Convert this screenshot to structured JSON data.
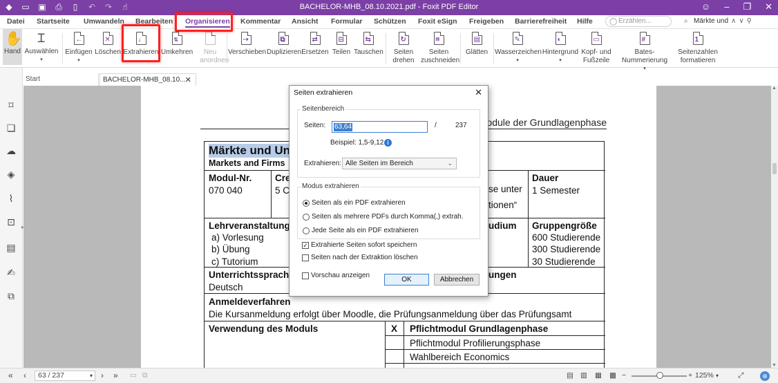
{
  "titlebar": {
    "title": "BACHELOR-MHB_08.10.2021.pdf - Foxit PDF Editor",
    "quick_access": [
      "logo-icon",
      "open-icon",
      "save-icon",
      "print-icon",
      "new-icon",
      "undo-icon",
      "redo-icon",
      "hand-select-icon"
    ],
    "controls": [
      "account-icon",
      "minimize-icon",
      "restore-icon",
      "close-icon"
    ]
  },
  "menu": {
    "items": [
      "Datei",
      "Startseite",
      "Umwandeln",
      "Bearbeiten",
      "Organisieren",
      "Kommentar",
      "Ansicht",
      "Formular",
      "Schützen",
      "Foxit eSign",
      "Freigeben",
      "Barrierefreiheit",
      "Hilfe"
    ],
    "active": "Organisieren",
    "tell_me_placeholder": "Erzählen...",
    "find_value": "Märkte und"
  },
  "ribbon": {
    "buttons": [
      {
        "label": "Hand",
        "icon": "hand-icon"
      },
      {
        "label": "Auswählen",
        "icon": "select-text-icon"
      },
      {
        "label": "Einfügen",
        "icon": "insert-page-icon"
      },
      {
        "label": "Löschen",
        "icon": "delete-page-icon"
      },
      {
        "label": "Extrahieren",
        "icon": "extract-page-icon"
      },
      {
        "label": "Umkehren",
        "icon": "reverse-pages-icon"
      },
      {
        "label": "Neu anordnen",
        "icon": "reorder-pages-icon"
      },
      {
        "label": "Verschieben",
        "icon": "move-pages-icon"
      },
      {
        "label": "Duplizieren",
        "icon": "duplicate-pages-icon"
      },
      {
        "label": "Ersetzen",
        "icon": "replace-pages-icon"
      },
      {
        "label": "Teilen",
        "icon": "split-pages-icon"
      },
      {
        "label": "Tauschen",
        "icon": "swap-pages-icon"
      },
      {
        "label": "Seiten drehen",
        "icon": "rotate-pages-icon"
      },
      {
        "label": "Seiten zuschneiden",
        "icon": "crop-pages-icon"
      },
      {
        "label": "Glätten",
        "icon": "flatten-icon"
      },
      {
        "label": "Wasserzeichen",
        "icon": "watermark-icon"
      },
      {
        "label": "Hintergrund",
        "icon": "background-icon"
      },
      {
        "label": "Kopf- und Fußzeile",
        "icon": "header-footer-icon"
      },
      {
        "label": "Bates-Nummerierung",
        "icon": "bates-numbering-icon"
      },
      {
        "label": "Seitenzahlen formatieren",
        "icon": "format-page-numbers-icon"
      }
    ]
  },
  "tabs": [
    {
      "label": "Start"
    },
    {
      "label": "BACHELOR-MHB_08.10...."
    }
  ],
  "document": {
    "header": "module der Grundlagenphase",
    "module_title": "Märkte und Unt",
    "module_subtitle": "Markets and Firms",
    "modul_nr_label": "Modul-Nr.",
    "modul_nr_value": "070 040",
    "credits_label": "Cre",
    "credits_value": "5 C",
    "col3_line1": "se unter",
    "col3_line2": "tionen“",
    "dauer_label": "Dauer",
    "dauer_value": "1 Semester",
    "lehrveranstaltungen_label": "Lehrveranstaltunge",
    "lv_items": [
      "a) Vorlesung",
      "b) Übung",
      "c) Tutorium"
    ],
    "udium_label": "udium",
    "gruppengroesse_label": "Gruppengröße",
    "group_sizes": [
      "600 Studierende",
      "300 Studierende",
      "30 Studierende"
    ],
    "unterrichtssprache_label": "Unterrichtssprache",
    "unterrichtssprache_value": "Deutsch",
    "ungen_label": "ungen",
    "anmeldeverfahren_label": "Anmeldeverfahren",
    "anmeldeverfahren_text": "Die Kursanmeldung erfolgt über Moodle, die Prüfungsanmeldung über das Prüfungsamt",
    "verwendung_label": "Verwendung des Moduls",
    "x_mark": "X",
    "verwendung_items": [
      "Pflichtmodul Grundlagenphase",
      "Pflichtmodul Profilierungsphase",
      "Wahlbereich Economics"
    ]
  },
  "dialog": {
    "title": "Seiten extrahieren",
    "range_group": "Seitenbereich",
    "seiten_label": "Seiten:",
    "seiten_value": "63,64",
    "separator": "/",
    "total_pages": "237",
    "example": "Beispiel: 1,5-9,12",
    "extract_label": "Extrahieren:",
    "extract_option": "Alle Seiten im Bereich",
    "mode_group": "Modus extrahieren",
    "mode_options": [
      "Seiten als ein PDF extrahieren",
      "Seiten als mehrere PDFs durch Komma(,) extrah.",
      "Jede Seite als ein PDF extrahieren"
    ],
    "mode_selected": 0,
    "checkbox_save": "Extrahierte Seiten sofort speichern",
    "checkbox_save_checked": true,
    "checkbox_delete": "Seiten nach der Extraktion löschen",
    "checkbox_delete_checked": false,
    "checkbox_preview": "Vorschau anzeigen",
    "checkbox_preview_checked": false,
    "ok": "OK",
    "cancel": "Abbrechen"
  },
  "statusbar": {
    "page_value": "63 / 237",
    "zoom": "125%"
  },
  "colors": {
    "brand": "#7b3fa6",
    "highlight_box": "#ff1f1f",
    "selection": "#3d7fcf"
  }
}
